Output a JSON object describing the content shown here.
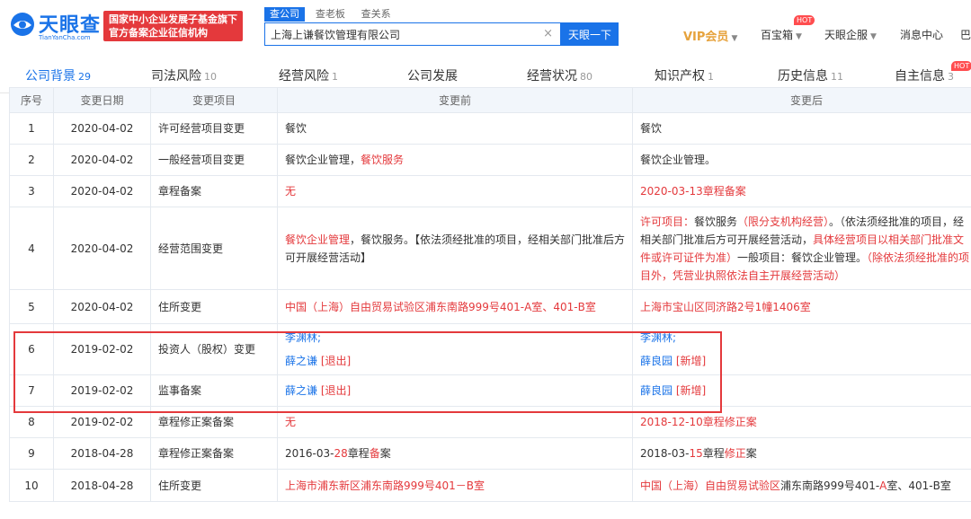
{
  "header": {
    "logo_text": "天眼查",
    "logo_sub": "TianYanCha.com",
    "badge_line1": "国家中小企业发展子基金旗下",
    "badge_line2": "官方备案企业征信机构",
    "search_tabs": [
      "查公司",
      "查老板",
      "查关系"
    ],
    "search_value": "上海上谦餐饮管理有限公司",
    "search_button": "天眼一下",
    "nav": {
      "vip": "VIP会员",
      "baibaoxiang": "百宝箱",
      "hot": "HOT",
      "enterprise": "天眼企服",
      "messages": "消息中心",
      "more": "巴"
    }
  },
  "module_tabs": [
    {
      "label": "公司背景",
      "count": "29"
    },
    {
      "label": "司法风险",
      "count": "10"
    },
    {
      "label": "经营风险",
      "count": "1"
    },
    {
      "label": "公司发展",
      "count": ""
    },
    {
      "label": "经营状况",
      "count": "80"
    },
    {
      "label": "知识产权",
      "count": "1"
    },
    {
      "label": "历史信息",
      "count": "11"
    },
    {
      "label": "自主信息",
      "count": "3"
    }
  ],
  "module_hot": "HOT",
  "table": {
    "headers": [
      "序号",
      "变更日期",
      "变更项目",
      "变更前",
      "变更后"
    ],
    "rows": [
      {
        "no": "1",
        "date": "2020-04-02",
        "item": "许可经营项目变更",
        "before": [
          {
            "t": "餐饮",
            "c": ""
          }
        ],
        "after": [
          {
            "t": "餐饮",
            "c": ""
          }
        ]
      },
      {
        "no": "2",
        "date": "2020-04-02",
        "item": "一般经营项目变更",
        "before": [
          {
            "t": "餐饮企业管理，",
            "c": ""
          },
          {
            "t": "餐饮服务",
            "c": "red"
          }
        ],
        "after": [
          {
            "t": "餐饮企业管理。",
            "c": ""
          }
        ]
      },
      {
        "no": "3",
        "date": "2020-04-02",
        "item": "章程备案",
        "before": [
          {
            "t": "无",
            "c": "red"
          }
        ],
        "after": [
          {
            "t": "2020-03-13章程备案",
            "c": "red"
          }
        ]
      },
      {
        "no": "4",
        "date": "2020-04-02",
        "item": "经营范围变更",
        "before": [
          {
            "t": "餐饮企业管理",
            "c": "red"
          },
          {
            "t": "，餐饮服务。【依法须经批准的项目，经相关部门批准后方可开展经营活动】",
            "c": ""
          }
        ],
        "after": [
          {
            "t": "许可项目：",
            "c": "red"
          },
          {
            "t": "餐饮服务",
            "c": ""
          },
          {
            "t": "（限分支机构经营）",
            "c": "red"
          },
          {
            "t": "。（依法须经批准的项目，经相关部门批准后方可开展经营活动，",
            "c": ""
          },
          {
            "t": "具体经营项目以相关部门批准文件或许可证件为准）",
            "c": "red"
          },
          {
            "t": "一般项目：餐饮企业管理。",
            "c": ""
          },
          {
            "t": "（除依法须经批准的项目外，凭营业执照依法自主开展经营活动）",
            "c": "red"
          }
        ]
      },
      {
        "no": "5",
        "date": "2020-04-02",
        "item": "住所变更",
        "before": [
          {
            "t": "中国（上海）自由贸易试验区浦东南路999号401-A室、401-B室",
            "c": "red"
          }
        ],
        "after": [
          {
            "t": "上海市宝山区同济路2号1幢1406室",
            "c": "red"
          }
        ]
      },
      {
        "no": "6",
        "date": "2019-02-02",
        "item": "投资人（股权）变更",
        "before": [
          {
            "t": "李渊林;",
            "c": "blue",
            "br": true
          },
          {
            "t": "薛之谦",
            "c": "blue"
          },
          {
            "t": " [退出]",
            "c": "red"
          }
        ],
        "after": [
          {
            "t": "李渊林;",
            "c": "blue",
            "br": true
          },
          {
            "t": "薛良园",
            "c": "blue"
          },
          {
            "t": " [新增]",
            "c": "red"
          }
        ]
      },
      {
        "no": "7",
        "date": "2019-02-02",
        "item": "监事备案",
        "before": [
          {
            "t": "薛之谦",
            "c": "blue"
          },
          {
            "t": " [退出]",
            "c": "red"
          }
        ],
        "after": [
          {
            "t": "薛良园",
            "c": "blue"
          },
          {
            "t": " [新增]",
            "c": "red"
          }
        ]
      },
      {
        "no": "8",
        "date": "2019-02-02",
        "item": "章程修正案备案",
        "before": [
          {
            "t": "无",
            "c": "red"
          }
        ],
        "after": [
          {
            "t": "2018-12-10章程修正案",
            "c": "red"
          }
        ]
      },
      {
        "no": "9",
        "date": "2018-04-28",
        "item": "章程修正案备案",
        "before": [
          {
            "t": "2016-03-",
            "c": ""
          },
          {
            "t": "28",
            "c": "red"
          },
          {
            "t": "章程",
            "c": ""
          },
          {
            "t": "备",
            "c": "red"
          },
          {
            "t": "案",
            "c": ""
          }
        ],
        "after": [
          {
            "t": "2018-03-",
            "c": ""
          },
          {
            "t": "15",
            "c": "red"
          },
          {
            "t": "章程",
            "c": ""
          },
          {
            "t": "修正",
            "c": "red"
          },
          {
            "t": "案",
            "c": ""
          }
        ]
      },
      {
        "no": "10",
        "date": "2018-04-28",
        "item": "住所变更",
        "before": [
          {
            "t": "上海市浦东新区浦东南路999号401－B室",
            "c": "red"
          }
        ],
        "after": [
          {
            "t": "中国（上海）自由贸易试验区",
            "c": "red"
          },
          {
            "t": "浦东南路999号401-",
            "c": ""
          },
          {
            "t": "A",
            "c": "red"
          },
          {
            "t": "室、401-B室",
            "c": ""
          }
        ]
      }
    ]
  }
}
